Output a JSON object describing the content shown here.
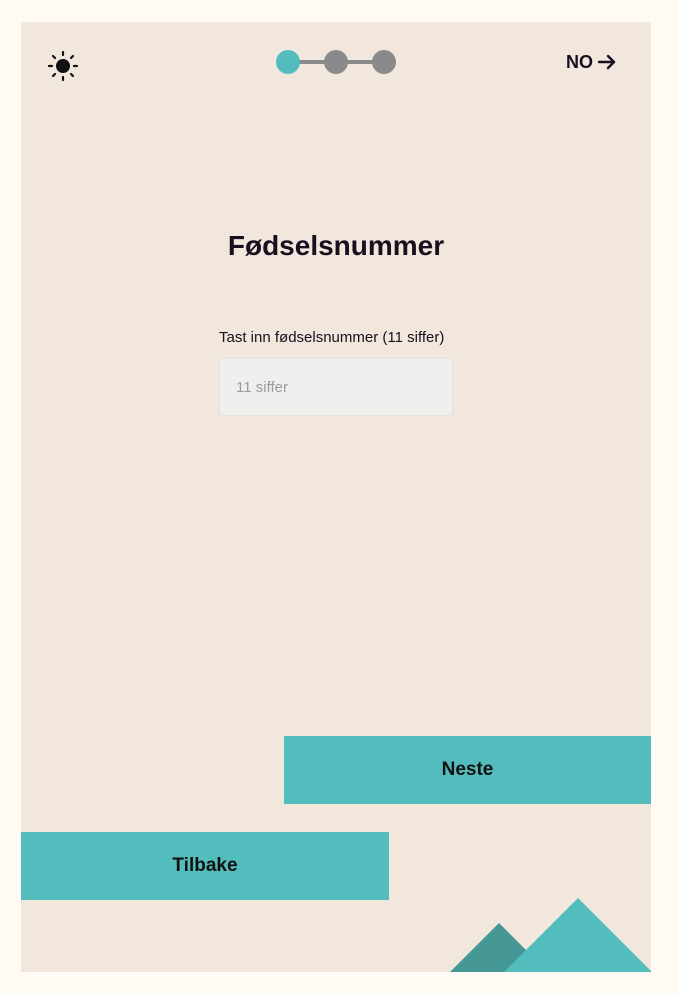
{
  "header": {
    "theme_icon": "sun-icon",
    "progress": {
      "total_steps": 3,
      "current_step": 1,
      "active_color": "#52bdbc",
      "inactive_color": "#8a8a8a"
    },
    "language": {
      "label": "NO",
      "icon": "arrow-right-icon"
    }
  },
  "main": {
    "title": "Fødselsnummer",
    "field": {
      "label": "Tast inn fødselsnummer (11 siffer)",
      "placeholder": "11 siffer",
      "value": ""
    }
  },
  "actions": {
    "next_label": "Neste",
    "back_label": "Tilbake"
  },
  "colors": {
    "page_background": "#fffaf4",
    "card_background": "#f2e7dc",
    "accent": "#52bdbc",
    "accent_dark": "#459796",
    "text": "#1a0e1f"
  }
}
